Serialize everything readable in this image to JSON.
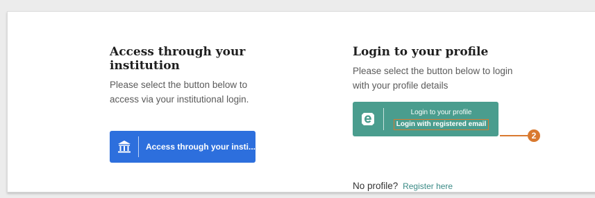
{
  "institution": {
    "heading": "Access through your institution",
    "description": "Please select the button below to access via your institutional login.",
    "button_label": "Access through your insti..."
  },
  "profile": {
    "heading": "Login to your profile",
    "description": "Please select the button below to login with your profile details",
    "button_line1": "Login to your profile",
    "button_line2": "Login with registered email",
    "no_profile_text": "No profile?",
    "register_link": "Register here"
  },
  "callout": {
    "number": "2"
  },
  "colors": {
    "institution_button": "#2d6fdd",
    "profile_button": "#4a9d8e",
    "callout": "#d9792f",
    "link": "#3a8a86"
  },
  "icons": {
    "institution": "bank-building-icon",
    "profile": "e-logo-icon"
  }
}
